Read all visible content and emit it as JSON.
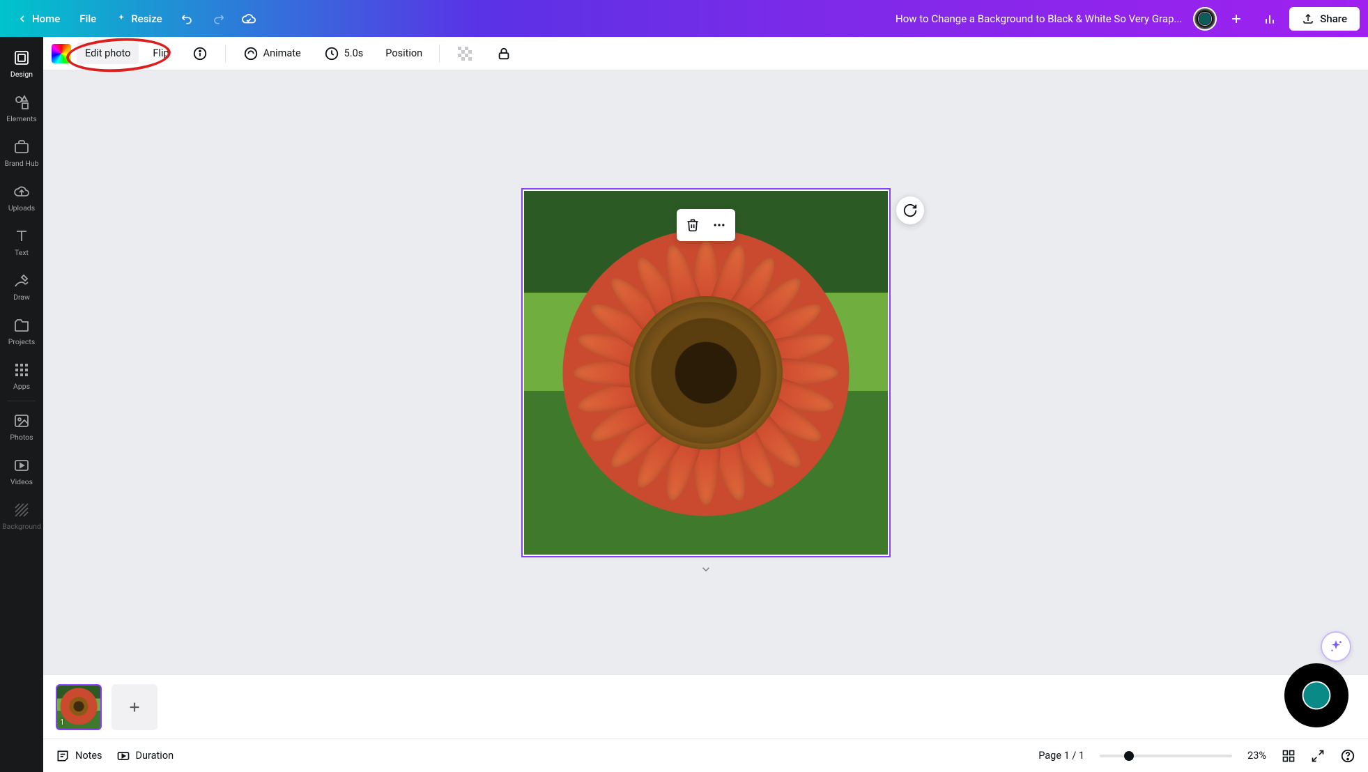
{
  "header": {
    "home": "Home",
    "file": "File",
    "resize": "Resize",
    "title": "How to Change a Background to Black & White So Very Grap...",
    "share": "Share"
  },
  "sidebar": {
    "items": [
      {
        "label": "Design"
      },
      {
        "label": "Elements"
      },
      {
        "label": "Brand Hub"
      },
      {
        "label": "Uploads"
      },
      {
        "label": "Text"
      },
      {
        "label": "Draw"
      },
      {
        "label": "Projects"
      },
      {
        "label": "Apps"
      },
      {
        "label": "Photos"
      },
      {
        "label": "Videos"
      },
      {
        "label": "Background"
      }
    ]
  },
  "context": {
    "edit_photo": "Edit photo",
    "flip": "Flip",
    "animate": "Animate",
    "duration_value": "5.0s",
    "position": "Position"
  },
  "pages": {
    "thumb_number": "1"
  },
  "footer": {
    "notes": "Notes",
    "duration": "Duration",
    "page_indicator": "Page 1 / 1",
    "zoom": "23%"
  }
}
